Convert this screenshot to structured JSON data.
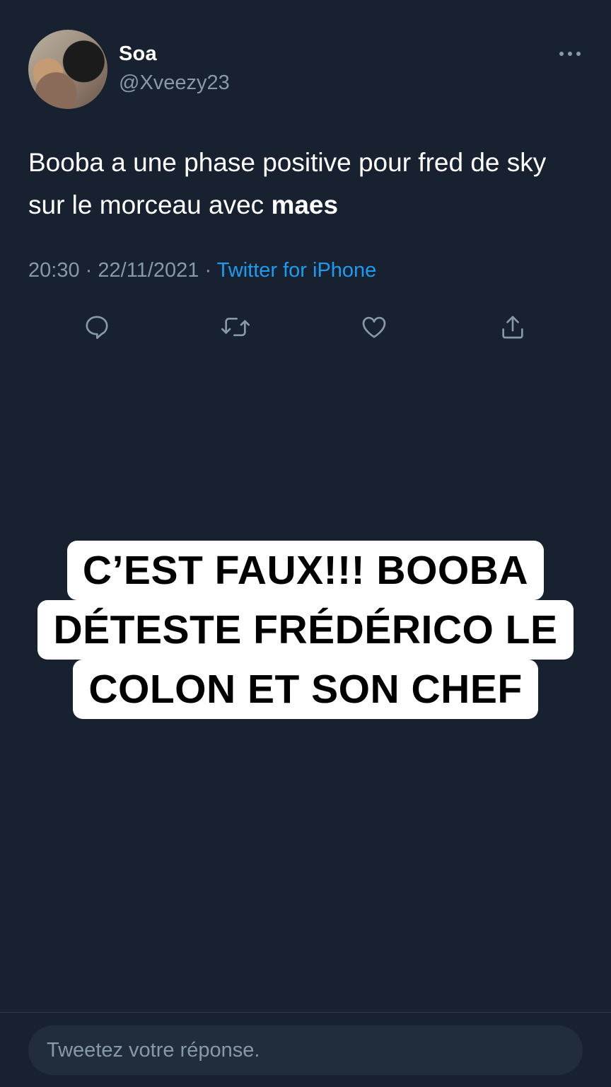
{
  "tweet": {
    "display_name": "Soa",
    "handle": "@Xveezy23",
    "text_part1": "Booba a une phase positive pour fred de sky sur le morceau avec ",
    "text_bold": "maes",
    "time": "20:30",
    "separator": "·",
    "date": "22/11/2021",
    "source": "Twitter for iPhone"
  },
  "icons": {
    "more": "more-dots-icon",
    "reply": "reply-bubble-icon",
    "retweet": "retweet-icon",
    "like": "heart-icon",
    "share": "share-upload-icon"
  },
  "overlay": {
    "lines": [
      "C’EST FAUX!!! BOOBA",
      "DÉTESTE FRÉDÉRICO LE",
      "COLON ET SON CHEF"
    ]
  },
  "reply": {
    "placeholder": "Tweetez votre réponse."
  },
  "colors": {
    "background": "#172130",
    "secondary_text": "#8899a6",
    "link": "#1d9bf0"
  }
}
